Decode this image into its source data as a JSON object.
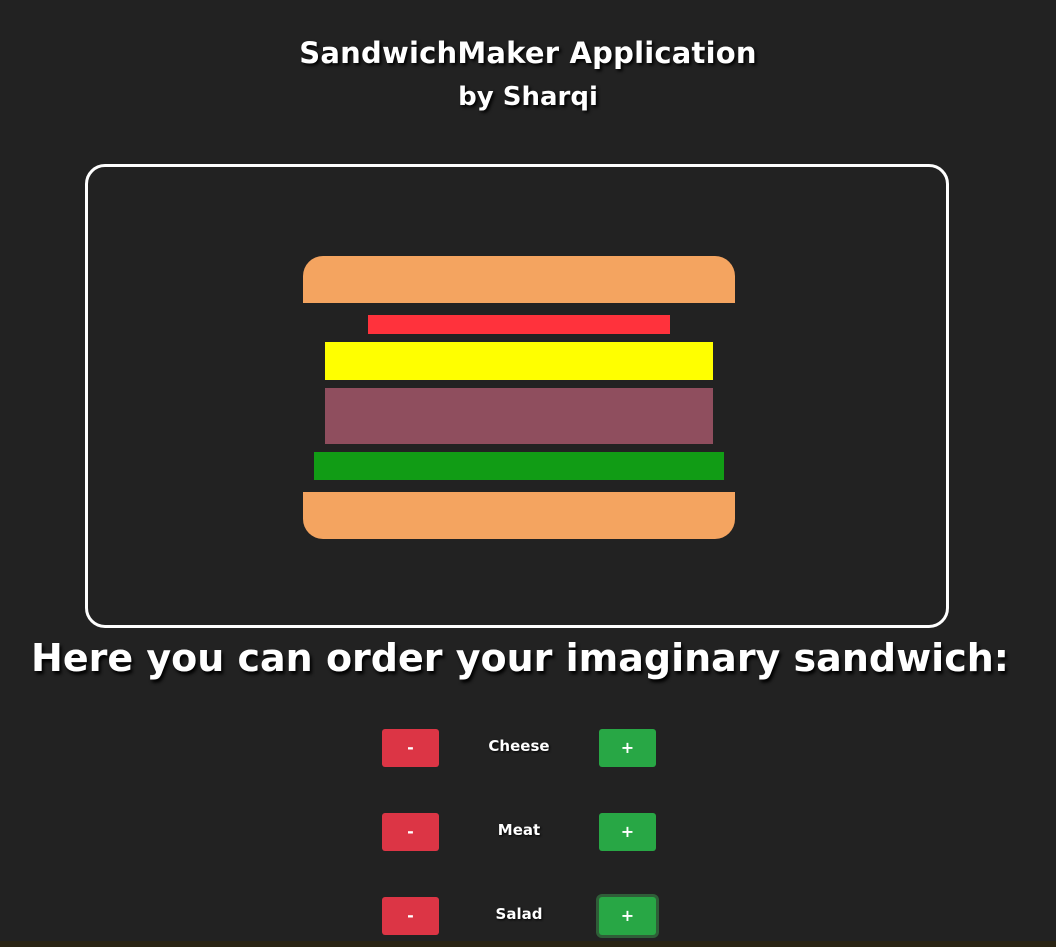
{
  "header": {
    "title": "SandwichMaker Application",
    "subtitle": "by Sharqi"
  },
  "sandwich": {
    "layers": [
      {
        "name": "bread-top",
        "color": "#f4a460"
      },
      {
        "name": "bacon",
        "color": "#ff323c"
      },
      {
        "name": "cheese",
        "color": "#ffff00"
      },
      {
        "name": "meat",
        "color": "#8f4e5e"
      },
      {
        "name": "salad",
        "color": "#119c15"
      },
      {
        "name": "bread-bottom",
        "color": "#f4a460"
      }
    ]
  },
  "order": {
    "heading": "Here you can order your imaginary sandwich:"
  },
  "controls": [
    {
      "label": "Cheese",
      "less_label": "-",
      "more_label": "+"
    },
    {
      "label": "Meat",
      "less_label": "-",
      "more_label": "+"
    },
    {
      "label": "Salad",
      "less_label": "-",
      "more_label": "+"
    }
  ],
  "colors": {
    "background": "#222222",
    "less_button": "#dc3545",
    "more_button": "#28a745",
    "frame_border": "#ffffff"
  }
}
